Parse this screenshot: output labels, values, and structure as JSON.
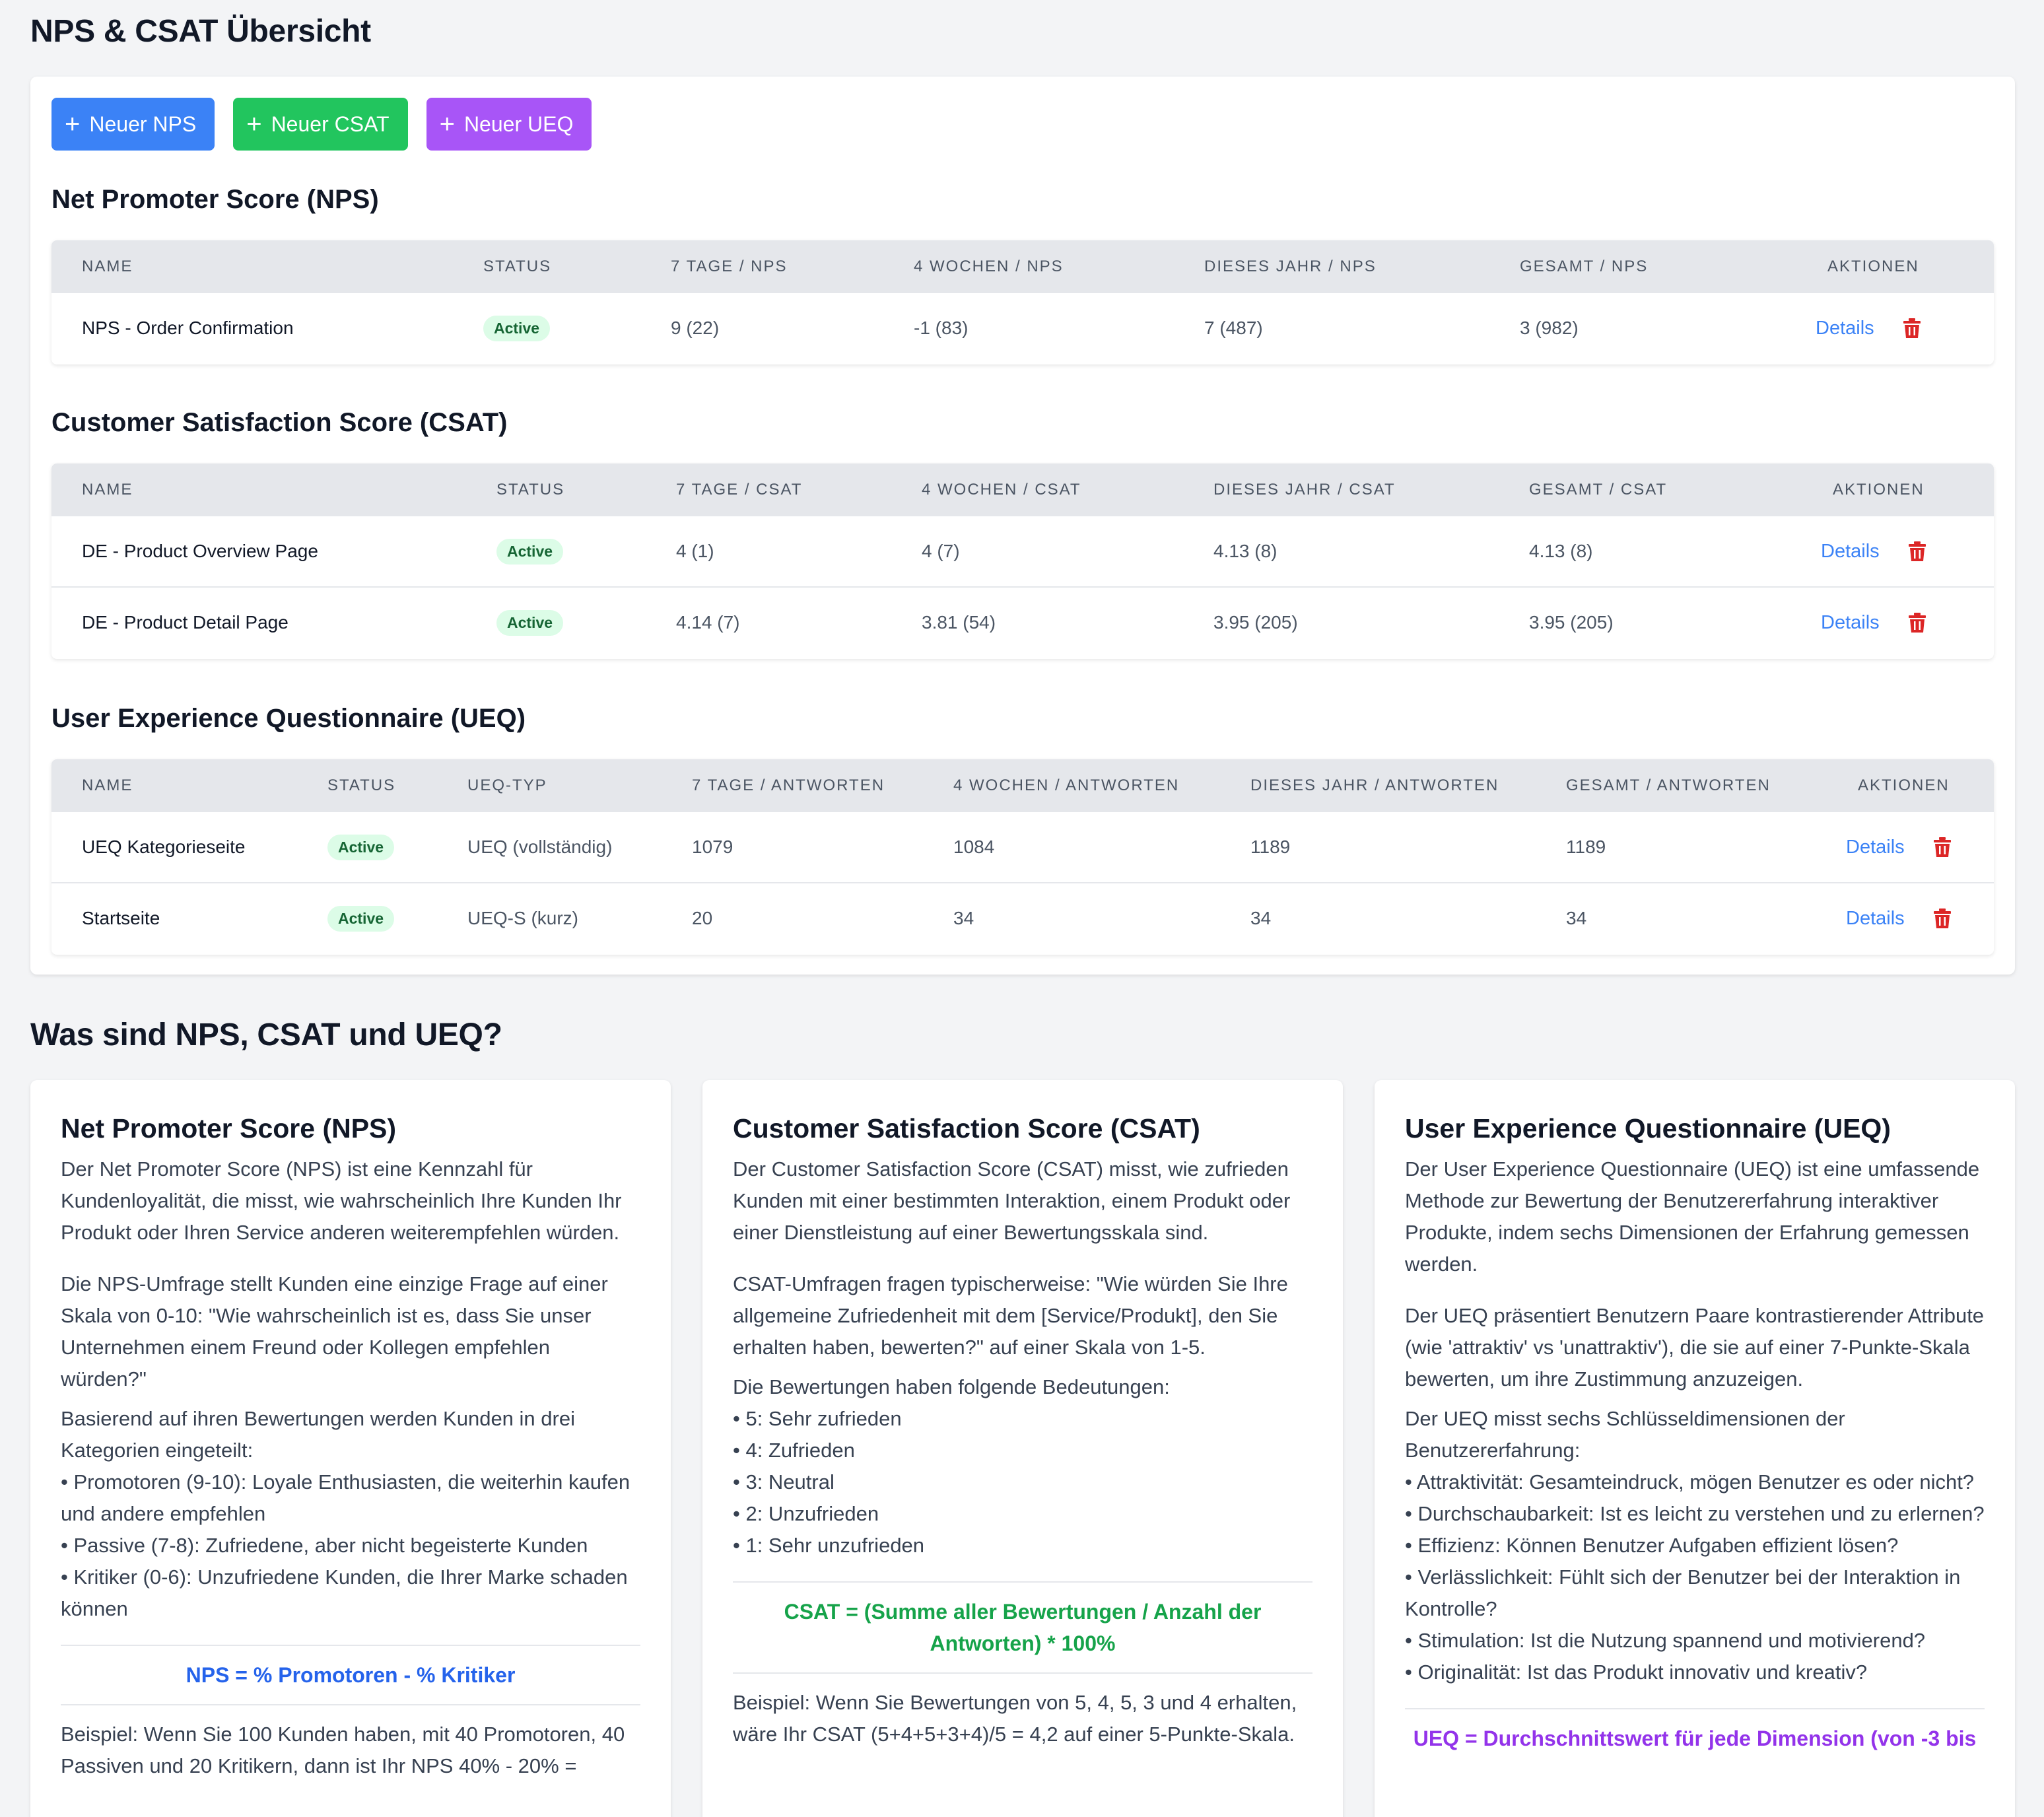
{
  "page_title": "NPS & CSAT Übersicht",
  "buttons": {
    "new_nps": "Neuer NPS",
    "new_csat": "Neuer CSAT",
    "new_ueq": "Neuer UEQ"
  },
  "nps": {
    "title": "Net Promoter Score (NPS)",
    "headers": [
      "Name",
      "Status",
      "7 Tage / NPS",
      "4 Wochen / NPS",
      "Dieses Jahr / NPS",
      "Gesamt / NPS",
      "Aktionen"
    ],
    "rows": [
      {
        "name": "NPS - Order Confirmation",
        "status": "Active",
        "d7": "9 (22)",
        "w4": "-1 (83)",
        "year": "7 (487)",
        "total": "3 (982)",
        "details": "Details"
      }
    ]
  },
  "csat": {
    "title": "Customer Satisfaction Score (CSAT)",
    "headers": [
      "Name",
      "Status",
      "7 Tage / CSAT",
      "4 Wochen / CSAT",
      "Dieses Jahr / CSAT",
      "Gesamt / CSAT",
      "Aktionen"
    ],
    "rows": [
      {
        "name": "DE - Product Overview Page",
        "status": "Active",
        "d7": "4 (1)",
        "w4": "4 (7)",
        "year": "4.13 (8)",
        "total": "4.13 (8)",
        "details": "Details"
      },
      {
        "name": "DE - Product Detail Page",
        "status": "Active",
        "d7": "4.14 (7)",
        "w4": "3.81 (54)",
        "year": "3.95 (205)",
        "total": "3.95 (205)",
        "details": "Details"
      }
    ]
  },
  "ueq": {
    "title": "User Experience Questionnaire (UEQ)",
    "headers": [
      "Name",
      "Status",
      "UEQ-Typ",
      "7 Tage / Antworten",
      "4 Wochen / Antworten",
      "Dieses Jahr / Antworten",
      "Gesamt / Antworten",
      "Aktionen"
    ],
    "rows": [
      {
        "name": "UEQ Kategorieseite",
        "status": "Active",
        "type": "UEQ (vollständig)",
        "d7": "1079",
        "w4": "1084",
        "year": "1189",
        "total": "1189",
        "details": "Details"
      },
      {
        "name": "Startseite",
        "status": "Active",
        "type": "UEQ-S (kurz)",
        "d7": "20",
        "w4": "34",
        "year": "34",
        "total": "34",
        "details": "Details"
      }
    ]
  },
  "info": {
    "title": "Was sind NPS, CSAT und UEQ?",
    "nps_card": {
      "title": "Net Promoter Score (NPS)",
      "p1": "Der Net Promoter Score (NPS) ist eine Kennzahl für Kundenloyalität, die misst, wie wahrscheinlich Ihre Kunden Ihr Produkt oder Ihren Service anderen weiterempfehlen würden.",
      "p2": "Die NPS-Umfrage stellt Kunden eine einzige Frage auf einer Skala von 0-10: \"Wie wahrscheinlich ist es, dass Sie unser Unternehmen einem Freund oder Kollegen empfehlen würden?\"",
      "p3": "Basierend auf ihren Bewertungen werden Kunden in drei Kategorien eingeteilt:",
      "b1": "• Promotoren (9-10): Loyale Enthusiasten, die weiterhin kaufen und andere empfehlen",
      "b2": "• Passive (7-8): Zufriedene, aber nicht begeisterte Kunden",
      "b3": "• Kritiker (0-6): Unzufriedene Kunden, die Ihrer Marke schaden können",
      "formula": "NPS = % Promotoren - % Kritiker",
      "example": "Beispiel: Wenn Sie 100 Kunden haben, mit 40 Promotoren, 40 Passiven und 20 Kritikern, dann ist Ihr NPS 40% - 20% ="
    },
    "csat_card": {
      "title": "Customer Satisfaction Score (CSAT)",
      "p1": "Der Customer Satisfaction Score (CSAT) misst, wie zufrieden Kunden mit einer bestimmten Interaktion, einem Produkt oder einer Dienstleistung auf einer Bewertungsskala sind.",
      "p2": "CSAT-Umfragen fragen typischerweise: \"Wie würden Sie Ihre allgemeine Zufriedenheit mit dem [Service/Produkt], den Sie erhalten haben, bewerten?\" auf einer Skala von 1-5.",
      "p3": "Die Bewertungen haben folgende Bedeutungen:",
      "b1": "• 5: Sehr zufrieden",
      "b2": "• 4: Zufrieden",
      "b3": "• 3: Neutral",
      "b4": "• 2: Unzufrieden",
      "b5": "• 1: Sehr unzufrieden",
      "formula": "CSAT = (Summe aller Bewertungen / Anzahl der Antworten) * 100%",
      "example": "Beispiel: Wenn Sie Bewertungen von 5, 4, 5, 3 und 4 erhalten, wäre Ihr CSAT (5+4+5+3+4)/5 = 4,2 auf einer 5-Punkte-Skala."
    },
    "ueq_card": {
      "title": "User Experience Questionnaire (UEQ)",
      "p1": "Der User Experience Questionnaire (UEQ) ist eine umfassende Methode zur Bewertung der Benutzererfahrung interaktiver Produkte, indem sechs Dimensionen der Erfahrung gemessen werden.",
      "p2": "Der UEQ präsentiert Benutzern Paare kontrastierender Attribute (wie 'attraktiv' vs 'unattraktiv'), die sie auf einer 7-Punkte-Skala bewerten, um ihre Zustimmung anzuzeigen.",
      "p3": "Der UEQ misst sechs Schlüsseldimensionen der Benutzererfahrung:",
      "b1": "• Attraktivität: Gesamteindruck, mögen Benutzer es oder nicht?",
      "b2": "• Durchschaubarkeit: Ist es leicht zu verstehen und zu erlernen?",
      "b3": "• Effizienz: Können Benutzer Aufgaben effizient lösen?",
      "b4": "• Verlässlichkeit: Fühlt sich der Benutzer bei der Interaktion in Kontrolle?",
      "b5": "• Stimulation: Ist die Nutzung spannend und motivierend?",
      "b6": "• Originalität: Ist das Produkt innovativ und kreativ?",
      "formula": "UEQ = Durchschnittswert für jede Dimension (von -3 bis"
    }
  },
  "colors": {
    "nps": "#3b82f6",
    "csat": "#22c55e",
    "ueq": "#a855f7",
    "danger": "#dc2626",
    "badge_bg": "#dcfce7",
    "badge_text": "#166534"
  }
}
